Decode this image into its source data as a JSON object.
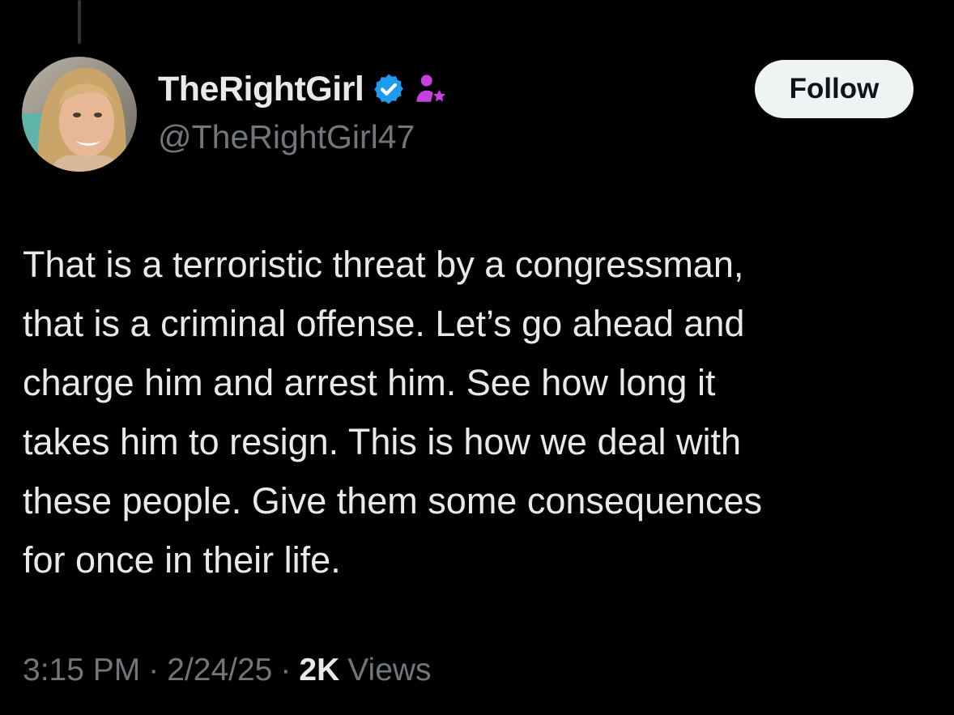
{
  "author": {
    "display_name": "TheRightGirl",
    "handle": "@TheRightGirl47",
    "verified_icon": "verified-badge-icon",
    "affiliate_icon": "affiliate-person-star-icon"
  },
  "follow_button": {
    "label": "Follow"
  },
  "tweet": {
    "text": "That is a terroristic threat by a congressman,\nthat is a criminal offense. Let’s go ahead and\ncharge him and arrest him. See how long it\ntakes him to resign. This is how we deal with\nthese people. Give them some consequences\nfor once in their life."
  },
  "meta": {
    "time": "3:15 PM",
    "separator": "·",
    "date": "2/24/25",
    "views_count": "2K",
    "views_label": "Views"
  },
  "colors": {
    "background": "#000000",
    "primary_text": "#e7e9ea",
    "secondary_text": "#71767b",
    "verified_blue": "#1d9bf0",
    "affiliate_magenta": "#c940e0",
    "follow_bg": "#eff3f4"
  }
}
